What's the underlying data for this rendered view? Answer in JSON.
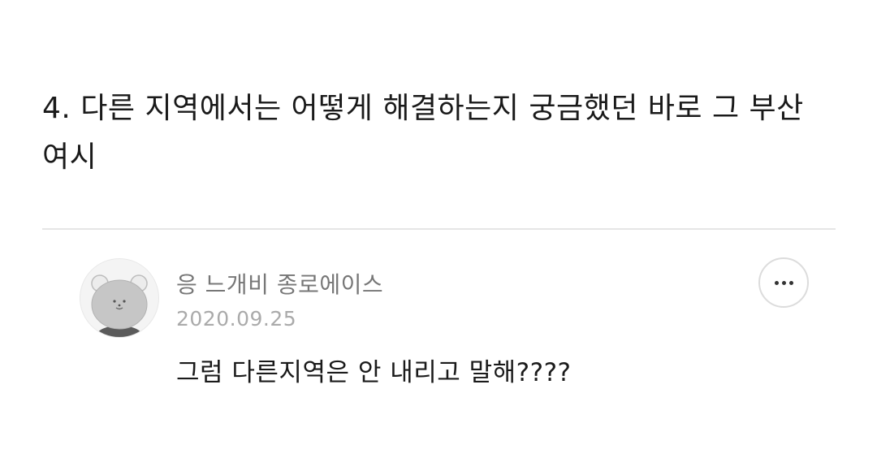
{
  "post": {
    "body": "4. 다른 지역에서는 어떻게 해결하는지 궁금했던 바로 그 부산\n여시"
  },
  "comment": {
    "author": "응 느개비 종로에이스",
    "date": "2020.09.25",
    "text": "그럼 다른지역은 안 내리고 말해????",
    "avatar_icon": "bear-avatar-icon",
    "more_icon": "more-dots-icon"
  }
}
